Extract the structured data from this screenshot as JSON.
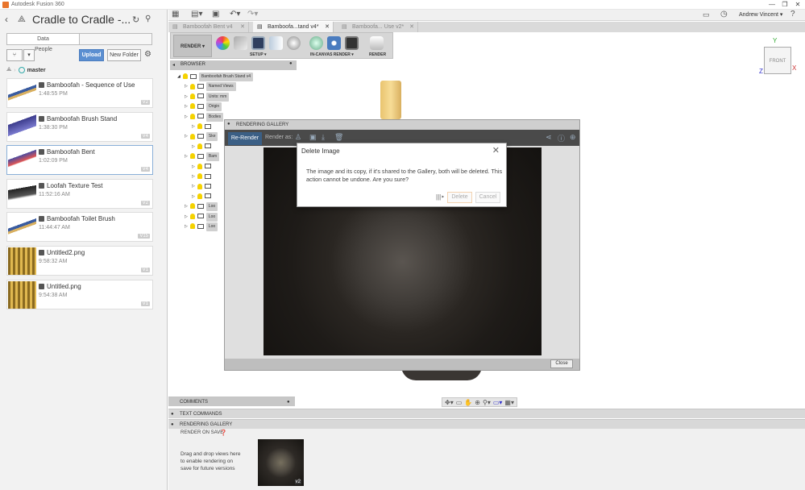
{
  "window": {
    "title": "Autodesk Fusion 360",
    "controls": [
      "—",
      "❐",
      "✕"
    ]
  },
  "data_panel": {
    "project_title": "Cradle to Cradle -...",
    "tabs": [
      "Data",
      "People"
    ],
    "upload_label": "Upload",
    "new_folder_label": "New Folder",
    "branch": "master",
    "files": [
      {
        "name": "Bamboofah - Sequence of Use",
        "time": "1:48:55 PM",
        "version": "V2",
        "thumb": "brush"
      },
      {
        "name": "Bamboofah Brush Stand",
        "time": "1:38:30 PM",
        "version": "V4",
        "thumb": "stand"
      },
      {
        "name": "Bamboofah Bent",
        "time": "1:02:09 PM",
        "version": "V4",
        "thumb": "bent"
      },
      {
        "name": "Loofah Texture Test",
        "time": "11:52:16 AM",
        "version": "V2",
        "thumb": "plate"
      },
      {
        "name": "Bamboofah Toilet Brush",
        "time": "11:44:47 AM",
        "version": "V15",
        "thumb": "brush"
      },
      {
        "name": "Untitled2.png",
        "time": "9:58:32 AM",
        "version": "V1",
        "thumb": "texture"
      },
      {
        "name": "Untitled.png",
        "time": "9:54:38 AM",
        "version": "V1",
        "thumb": "texture"
      }
    ]
  },
  "user": {
    "name": "Andrew Vincent ▾"
  },
  "doc_tabs": [
    {
      "label": "Bamboofah Bent v4",
      "active": false
    },
    {
      "label": "Bamboofa...tand v4*",
      "active": true
    },
    {
      "label": "Bamboofa... Use v2*",
      "active": false
    }
  ],
  "ribbon": {
    "workspace": "RENDER ▾",
    "groups": [
      "SETUP ▾",
      "IN-CANVAS RENDER ▾",
      "RENDER"
    ]
  },
  "browser": {
    "header": "BROWSER",
    "rows": [
      {
        "label": "Bamboofah Brush Stand v4",
        "indent": 0
      },
      {
        "label": "Named Views",
        "indent": 1
      },
      {
        "label": "Units: mm",
        "indent": 1
      },
      {
        "label": "Origin",
        "indent": 1
      },
      {
        "label": "Bodies",
        "indent": 1
      },
      {
        "label": "",
        "indent": 2
      },
      {
        "label": "Ske",
        "indent": 1
      },
      {
        "label": "",
        "indent": 2
      },
      {
        "label": "Bam",
        "indent": 1
      },
      {
        "label": "",
        "indent": 2
      },
      {
        "label": "",
        "indent": 2
      },
      {
        "label": "",
        "indent": 2
      },
      {
        "label": "",
        "indent": 2
      },
      {
        "label": "Loo",
        "indent": 1
      },
      {
        "label": "Loo",
        "indent": 1
      },
      {
        "label": "Loo",
        "indent": 1
      }
    ]
  },
  "rendering_gallery": {
    "title": "RENDERING GALLERY",
    "rerender_label": "Re-Render",
    "render_as_label": "Render as:",
    "close_label": "Close"
  },
  "dialog": {
    "title": "Delete Image",
    "message": "The image and its copy, if it's shared to the Gallery, both will be deleted. This action cannot be undone. Are you sure?",
    "delete_label": "Delete",
    "cancel_label": "Cancel"
  },
  "bottom": {
    "comments_label": "COMMENTS",
    "text_commands_label": "TEXT COMMANDS",
    "rendering_gallery_label": "RENDERING GALLERY",
    "render_on_save_label": "RENDER ON SAVE",
    "drag_hint": "Drag and drop views here to enable rendering on save for future versions",
    "thumb_version": "v2"
  },
  "viewcube": {
    "face": "FRONT"
  },
  "colors": {
    "accent": "#3b5f85",
    "upload": "#5b8fd1",
    "bulb": "#f5d200"
  }
}
